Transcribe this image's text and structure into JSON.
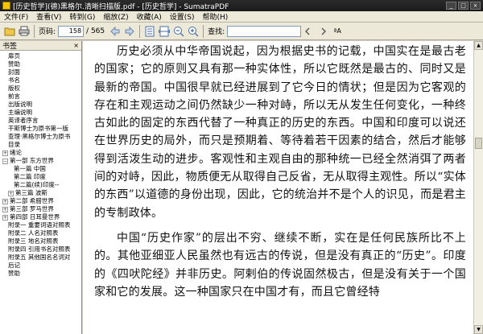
{
  "window": {
    "title": "[历史哲学](德)黑格尔.清晰扫描版.pdf - [历史哲学] - SumatraPDF",
    "min_glyph": "_",
    "max_glyph": "□",
    "close_glyph": "×"
  },
  "menu": [
    "文件(F)",
    "查看(V)",
    "转到(G)",
    "缩放(Z)",
    "收藏(A)",
    "设置(S)",
    "帮助(H)"
  ],
  "toolbar": {
    "page_label": "页码:",
    "page_value": "158",
    "page_total": "/ 565",
    "find_label": "查找:",
    "find_value": "",
    "case_glyph": "ªA"
  },
  "sidebar": {
    "title": "书签",
    "close_glyph": "×",
    "items": [
      {
        "label": "扉页",
        "indent": 1,
        "exp": ""
      },
      {
        "label": "赞助",
        "indent": 1,
        "exp": ""
      },
      {
        "label": "封面",
        "indent": 1,
        "exp": ""
      },
      {
        "label": "书名",
        "indent": 1,
        "exp": ""
      },
      {
        "label": "版权",
        "indent": 1,
        "exp": ""
      },
      {
        "label": "前言",
        "indent": 1,
        "exp": ""
      },
      {
        "label": "出版说明",
        "indent": 1,
        "exp": ""
      },
      {
        "label": "主编说明",
        "indent": 1,
        "exp": ""
      },
      {
        "label": "英译者序言",
        "indent": 1,
        "exp": ""
      },
      {
        "label": "干斯博士为原书第一版",
        "indent": 1,
        "exp": ""
      },
      {
        "label": "查理·黑格尔博士为原书",
        "indent": 1,
        "exp": ""
      },
      {
        "label": "目录",
        "indent": 1,
        "exp": ""
      },
      {
        "label": "绪论",
        "indent": 0,
        "exp": "+"
      },
      {
        "label": "第一部 东方世界",
        "indent": 0,
        "exp": "−"
      },
      {
        "label": "第一篇 中国",
        "indent": 2,
        "exp": ""
      },
      {
        "label": "第二篇 印度",
        "indent": 2,
        "exp": ""
      },
      {
        "label": "第二篇(续)印度--",
        "indent": 2,
        "exp": ""
      },
      {
        "label": "第三篇 波斯",
        "indent": 1,
        "exp": "+"
      },
      {
        "label": "第二部 希腊世界",
        "indent": 0,
        "exp": "+"
      },
      {
        "label": "第三部 罗马世界",
        "indent": 0,
        "exp": "+"
      },
      {
        "label": "第四部 日耳曼世界",
        "indent": 0,
        "exp": "+"
      },
      {
        "label": "附录一 重要词语对照表",
        "indent": 1,
        "exp": ""
      },
      {
        "label": "附录二 人名对照表",
        "indent": 1,
        "exp": ""
      },
      {
        "label": "附录三 地名对照表",
        "indent": 1,
        "exp": ""
      },
      {
        "label": "附录四 引用书名对照表",
        "indent": 1,
        "exp": ""
      },
      {
        "label": "附录五 其他国名名词对",
        "indent": 1,
        "exp": ""
      },
      {
        "label": "后记",
        "indent": 1,
        "exp": ""
      },
      {
        "label": "赞助",
        "indent": 1,
        "exp": ""
      }
    ]
  },
  "document": {
    "paragraphs": [
      "历史必须从中华帝国说起，因为根据史书的记载，中国实在是最古老的国家；它的原则又具有那一种实体性，所以它既然是最古的、同时又是最新的帝国。中国很早就已经进展到了它今日的情状；但是因为它客观的存在和主观运动之间仍然缺少一种对峙，所以无从发生任何变化，一种终古如此的固定的东西代替了一种真正的历史的东西。中国和印度可以说还在世界历史的局外，而只是预期着、等待着若干因素的结合，然后才能够得到活泼生动的进步。客观性和主观自由的那种统一已经全然消弭了两者间的对峙，因此，物质便无从取得自己反省，无从取得主观性。所以“实体的东西”以道德的身份出现，因此，它的统治并不是个人的识见，而是君主的专制政体。",
      "中国“历史作家”的层出不穷、继续不断，实在是任何民族所比不上的。其他亚细亚人民虽然也有远古的传说，但是没有真正的“历史”。印度的《四吠陀经》并非历史。阿剌伯的传说固然极古，但是没有关于一个国家和它的发展。这一种国家只在中国才有，而且它曾经特"
    ]
  },
  "scrollbar": {
    "up_glyph": "▲",
    "down_glyph": "▼"
  }
}
